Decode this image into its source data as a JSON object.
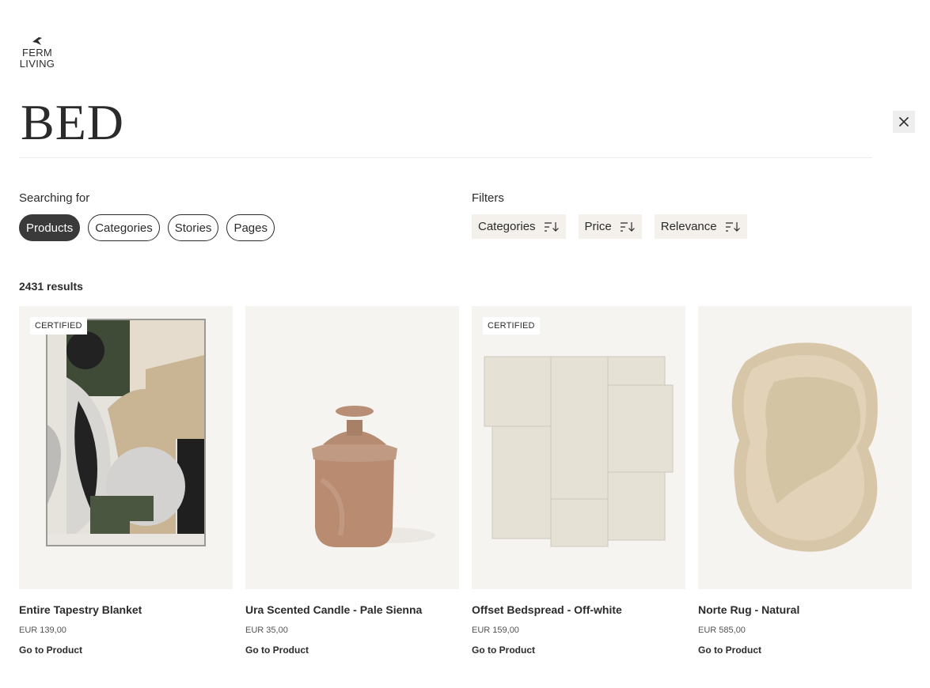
{
  "brand": {
    "logo_lines": [
      "FERM",
      "LIVING"
    ]
  },
  "search": {
    "term": "BED"
  },
  "searching_for": {
    "label": "Searching for",
    "options": [
      {
        "label": "Products",
        "active": true
      },
      {
        "label": "Categories",
        "active": false
      },
      {
        "label": "Stories",
        "active": false
      },
      {
        "label": "Pages",
        "active": false
      }
    ]
  },
  "filters": {
    "label": "Filters",
    "items": [
      {
        "label": "Categories"
      },
      {
        "label": "Price"
      },
      {
        "label": "Relevance"
      }
    ]
  },
  "results": {
    "count": "2431 results"
  },
  "products": [
    {
      "name": "Entire Tapestry Blanket",
      "price": "EUR 139,00",
      "badge": "CERTIFIED",
      "link": "Go to Product"
    },
    {
      "name": "Ura Scented Candle - Pale Sienna",
      "price": "EUR 35,00",
      "badge": "",
      "link": "Go to Product"
    },
    {
      "name": "Offset Bedspread - Off-white",
      "price": "EUR 159,00",
      "badge": "CERTIFIED",
      "link": "Go to Product"
    },
    {
      "name": "Norte Rug - Natural",
      "price": "EUR 585,00",
      "badge": "",
      "link": "Go to Product"
    }
  ],
  "icons": {
    "close": "close-icon",
    "sort": "sort-icon",
    "logo": "bird-logo-icon"
  },
  "colors": {
    "text": "#2b2b2b",
    "active_pill": "#3a3a3a",
    "filter_bg": "#f4f1ec",
    "image_bg": "#f6f4f1"
  }
}
